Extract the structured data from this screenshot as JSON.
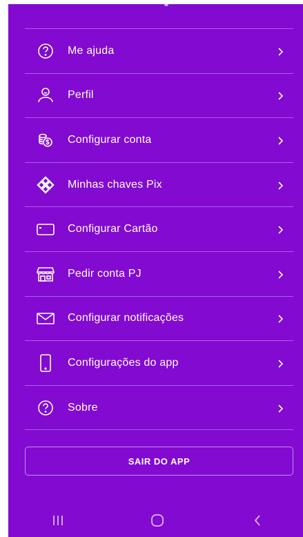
{
  "menu": {
    "items": [
      {
        "label": "Me ajuda",
        "icon": "help-circle-icon"
      },
      {
        "label": "Perfil",
        "icon": "profile-icon"
      },
      {
        "label": "Configurar conta",
        "icon": "coins-icon"
      },
      {
        "label": "Minhas chaves Pix",
        "icon": "pix-icon"
      },
      {
        "label": "Configurar Cartão",
        "icon": "card-icon"
      },
      {
        "label": "Pedir conta PJ",
        "icon": "store-icon"
      },
      {
        "label": "Configurar notificações",
        "icon": "envelope-icon"
      },
      {
        "label": "Configurações do app",
        "icon": "phone-icon"
      },
      {
        "label": "Sobre",
        "icon": "help-circle-icon"
      }
    ]
  },
  "logout": {
    "label": "SAIR DO APP"
  },
  "colors": {
    "background": "#820AD1",
    "text": "#ffffff"
  },
  "navbar": {
    "buttons": [
      "recents-icon",
      "home-icon",
      "back-icon"
    ]
  }
}
